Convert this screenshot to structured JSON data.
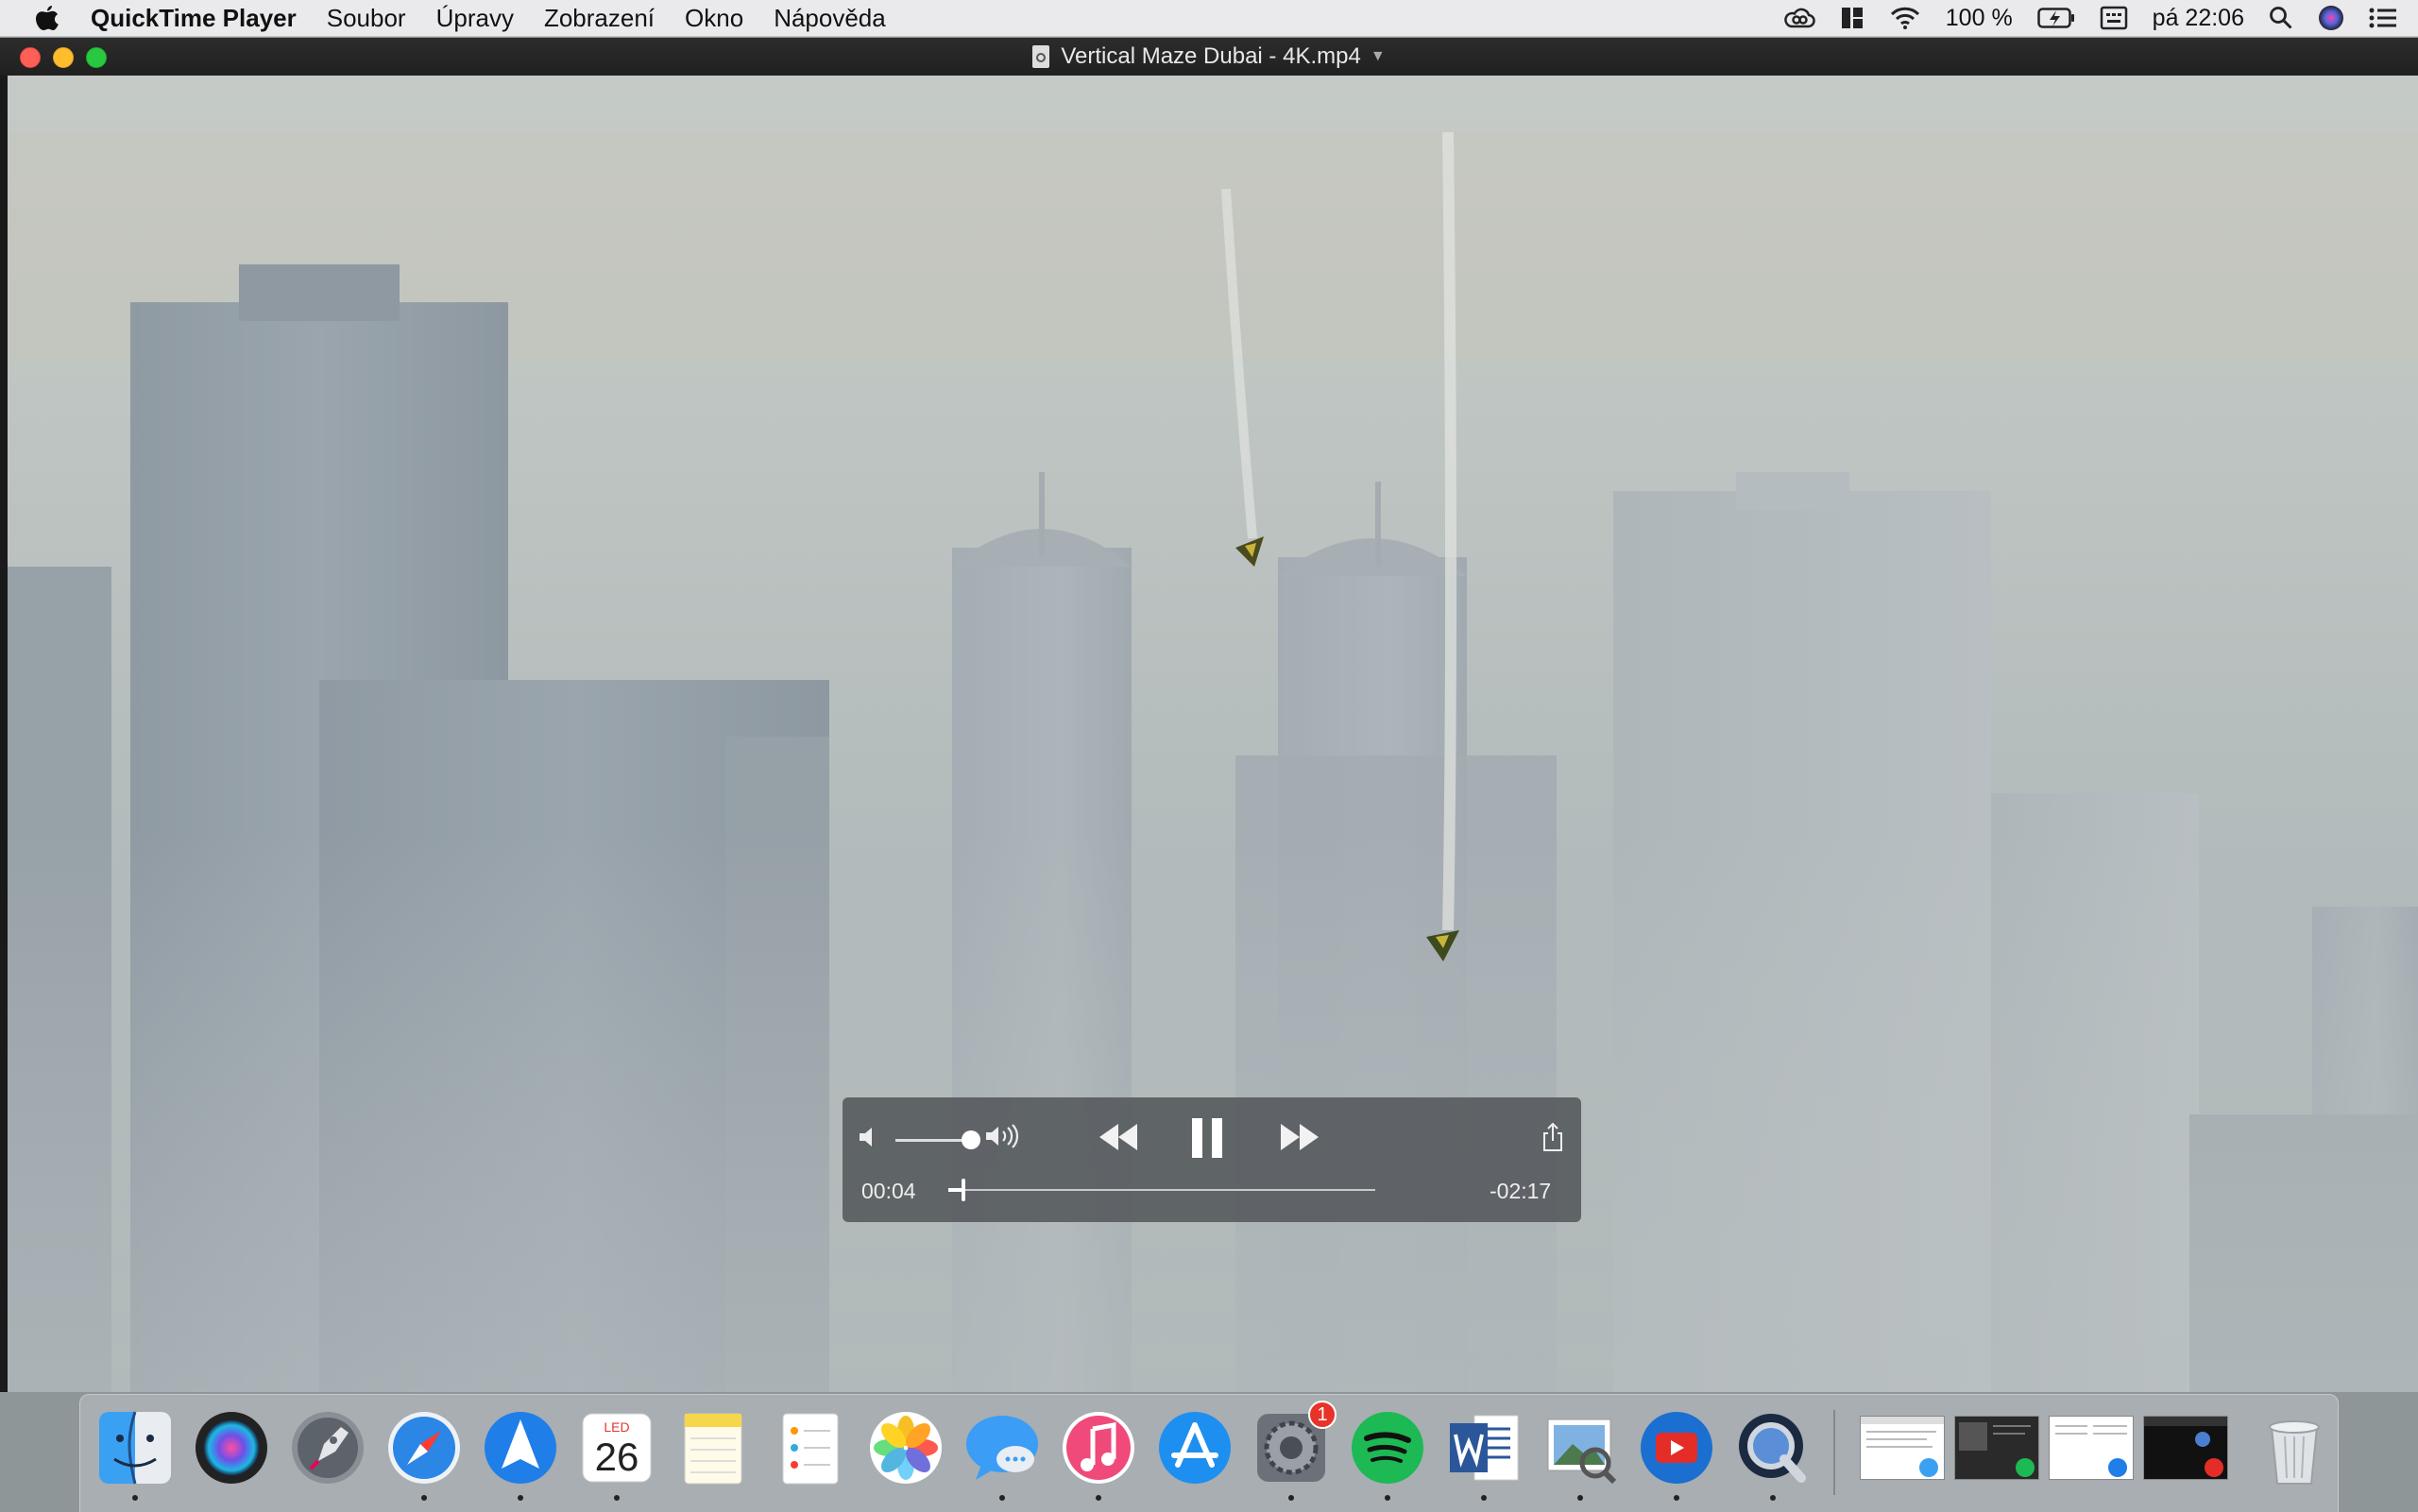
{
  "menubar": {
    "app_name": "QuickTime Player",
    "items": [
      "Soubor",
      "Úpravy",
      "Zobrazení",
      "Okno",
      "Nápověda"
    ],
    "battery": "100 %",
    "clock": "pá 22:06"
  },
  "window": {
    "title": "Vertical Maze Dubai - 4K.mp4"
  },
  "player": {
    "elapsed": "00:04",
    "remaining": "-02:17",
    "progress_fraction": 0.03,
    "volume_fraction": 1.0,
    "state": "playing"
  },
  "dock": {
    "apps": [
      {
        "name": "finder-icon",
        "running": true
      },
      {
        "name": "siri-icon",
        "running": false
      },
      {
        "name": "launchpad-icon",
        "running": false
      },
      {
        "name": "safari-icon",
        "running": true
      },
      {
        "name": "airmail-icon",
        "running": true
      },
      {
        "name": "calendar-icon",
        "running": true
      },
      {
        "name": "notes-icon",
        "running": false
      },
      {
        "name": "reminders-icon",
        "running": false
      },
      {
        "name": "photos-icon",
        "running": false
      },
      {
        "name": "messages-icon",
        "running": true
      },
      {
        "name": "itunes-icon",
        "running": true
      },
      {
        "name": "app-store-icon",
        "running": false
      },
      {
        "name": "system-preferences-icon",
        "running": true
      },
      {
        "name": "spotify-icon",
        "running": true
      },
      {
        "name": "word-icon",
        "running": true
      },
      {
        "name": "preview-icon",
        "running": true
      },
      {
        "name": "youtube-icon",
        "running": true
      },
      {
        "name": "quicktime-icon",
        "running": true
      }
    ],
    "calendar_month": "LED",
    "calendar_day": "26",
    "sysprefs_badge": "1",
    "colors": {
      "finder": "#3aa0f2",
      "siri": "#2a2a4a",
      "launchpad": "#8a8f96",
      "safari": "#2b86e6",
      "airmail": "#1f7ee8",
      "notes": "#f6d64a",
      "messages": "#3b9df5",
      "itunes": "#f04a7a",
      "app_store": "#1d8ff0",
      "spotify": "#1db954",
      "word": "#2b579a",
      "youtube": "#1a6fd1",
      "quicktime": "#1b2a40"
    }
  }
}
